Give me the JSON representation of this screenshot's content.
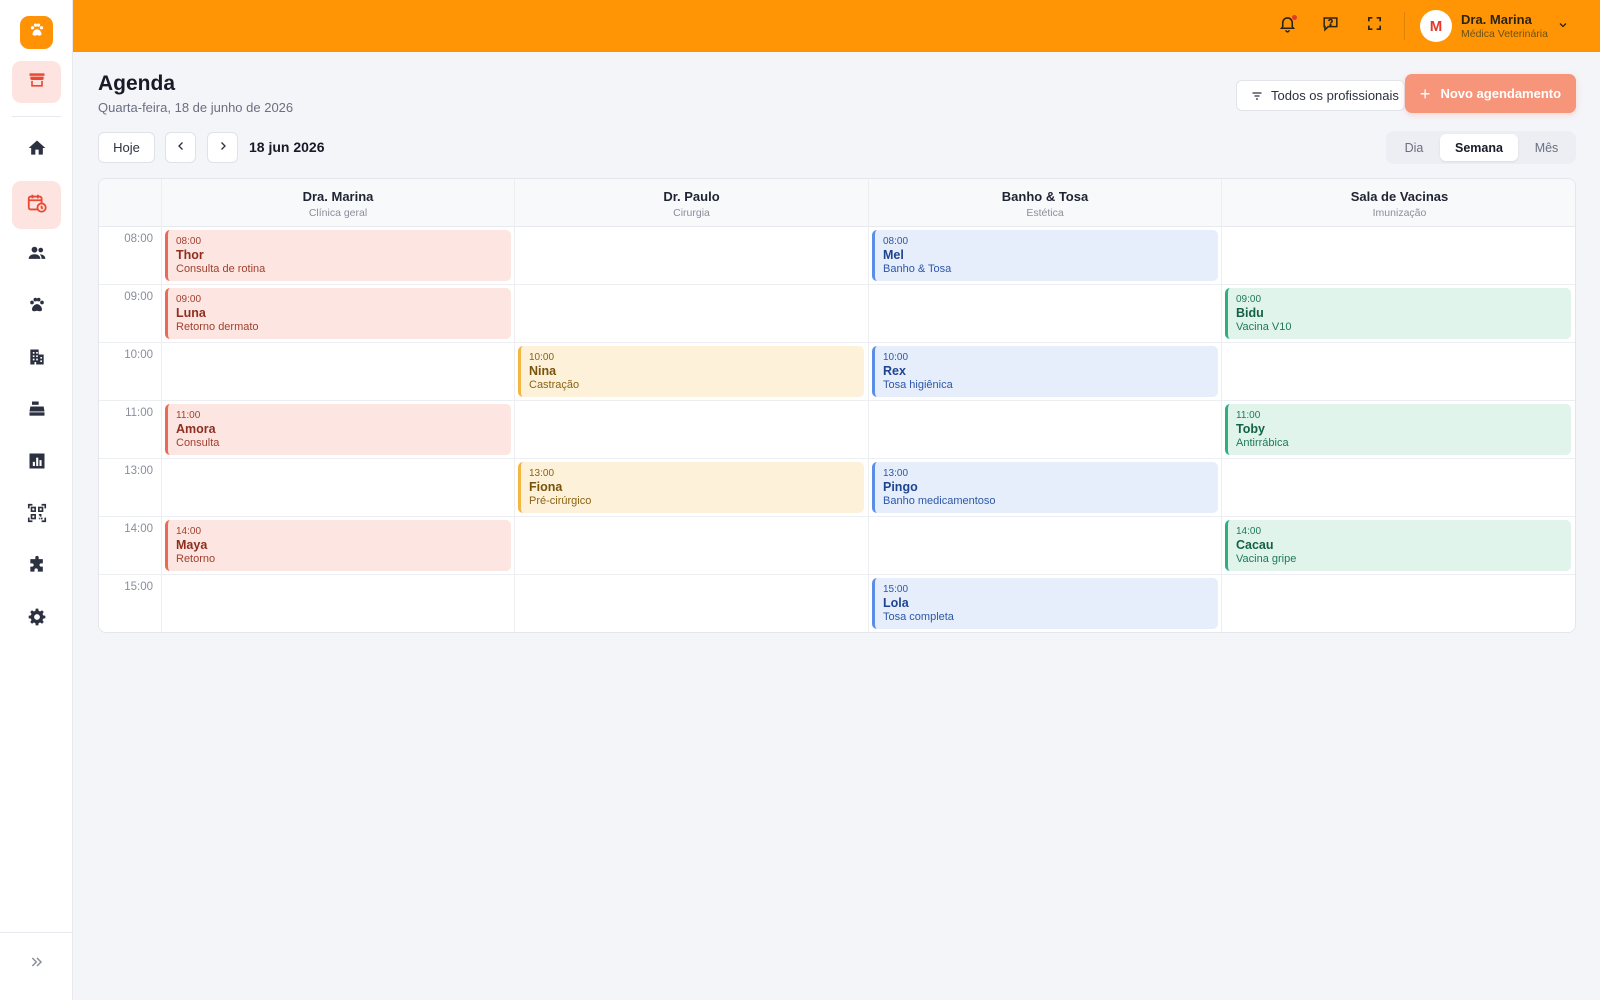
{
  "colors": {
    "topbar": "#ff9505",
    "accent_red": "#e5382b",
    "primary_button": "#f7957a"
  },
  "sidebar": {
    "logo_icon": "paw-icon",
    "top_item": "store-icon",
    "items": [
      {
        "icon": "home-icon"
      },
      {
        "icon": "calendar-clock-icon",
        "active": true
      },
      {
        "icon": "users-icon"
      },
      {
        "icon": "paw-icon"
      },
      {
        "icon": "building-icon"
      },
      {
        "icon": "cash-register-icon"
      },
      {
        "icon": "bar-chart-icon"
      },
      {
        "icon": "qr-code-icon"
      },
      {
        "icon": "puzzle-icon"
      },
      {
        "icon": "settings-icon"
      }
    ],
    "expand_icon": "chevrons-right-icon"
  },
  "topbar": {
    "icons": [
      "bell-icon",
      "chat-help-icon",
      "fullscreen-icon"
    ],
    "user": {
      "initial": "M",
      "name": "Dra. Marina",
      "role": "Médica Veterinária"
    }
  },
  "header": {
    "title": "Agenda",
    "date": "Quarta-feira, 18 de junho de 2026",
    "filter_label": "Todos os profissionais",
    "new_button_label": "Novo agendamento"
  },
  "toolbar": {
    "today_label": "Hoje",
    "current_date": "18 jun 2026",
    "views": [
      "Dia",
      "Semana",
      "Mês"
    ],
    "active_view": "Semana"
  },
  "calendar": {
    "columns": [
      {
        "name": "Dra. Marina",
        "sub": "Clínica geral"
      },
      {
        "name": "Dr. Paulo",
        "sub": "Cirurgia"
      },
      {
        "name": "Banho & Tosa",
        "sub": "Estética"
      },
      {
        "name": "Sala de Vacinas",
        "sub": "Imunização"
      }
    ],
    "times": [
      "08:00",
      "09:00",
      "10:00",
      "11:00",
      "13:00",
      "14:00",
      "15:00"
    ],
    "appointments": [
      {
        "col": 0,
        "row": 0,
        "time": "08:00",
        "pet": "Thor",
        "service": "Consulta de rotina",
        "color": "red"
      },
      {
        "col": 0,
        "row": 1,
        "time": "09:00",
        "pet": "Luna",
        "service": "Retorno dermato",
        "color": "red"
      },
      {
        "col": 0,
        "row": 3,
        "time": "11:00",
        "pet": "Amora",
        "service": "Consulta",
        "color": "red"
      },
      {
        "col": 0,
        "row": 5,
        "time": "14:00",
        "pet": "Maya",
        "service": "Retorno",
        "color": "red"
      },
      {
        "col": 1,
        "row": 2,
        "time": "10:00",
        "pet": "Nina",
        "service": "Castração",
        "color": "yellow"
      },
      {
        "col": 1,
        "row": 4,
        "time": "13:00",
        "pet": "Fiona",
        "service": "Pré-cirúrgico",
        "color": "yellow"
      },
      {
        "col": 2,
        "row": 0,
        "time": "08:00",
        "pet": "Mel",
        "service": "Banho & Tosa",
        "color": "blue"
      },
      {
        "col": 2,
        "row": 2,
        "time": "10:00",
        "pet": "Rex",
        "service": "Tosa higiênica",
        "color": "blue"
      },
      {
        "col": 2,
        "row": 4,
        "time": "13:00",
        "pet": "Pingo",
        "service": "Banho medicamentoso",
        "color": "blue"
      },
      {
        "col": 2,
        "row": 6,
        "time": "15:00",
        "pet": "Lola",
        "service": "Tosa completa",
        "color": "blue"
      },
      {
        "col": 3,
        "row": 1,
        "time": "09:00",
        "pet": "Bidu",
        "service": "Vacina V10",
        "color": "green"
      },
      {
        "col": 3,
        "row": 3,
        "time": "11:00",
        "pet": "Toby",
        "service": "Antirrábica",
        "color": "green"
      },
      {
        "col": 3,
        "row": 5,
        "time": "14:00",
        "pet": "Cacau",
        "service": "Vacina gripe",
        "color": "green"
      }
    ]
  }
}
